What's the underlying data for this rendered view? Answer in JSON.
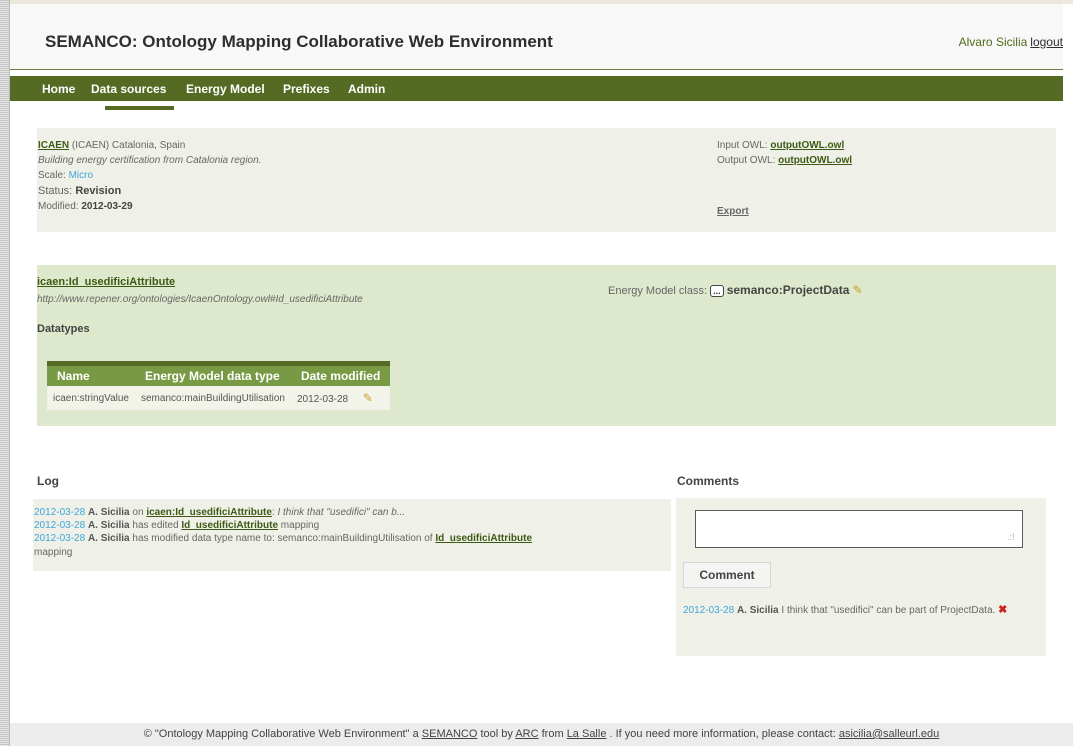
{
  "header": {
    "title": "SEMANCO: Ontology Mapping Collaborative Web Environment",
    "user_name": "Alvaro Sicilia",
    "logout_label": "logout"
  },
  "nav": {
    "items": [
      "Home",
      "Data sources",
      "Energy Model",
      "Prefixes",
      "Admin"
    ],
    "active": "Data sources"
  },
  "source": {
    "name": "ICAEN",
    "qualifier": "(ICAEN) Catalonia, Spain",
    "description": "Building energy certification from Catalonia region.",
    "scale_label": "Scale:",
    "scale_value": "Micro",
    "status_label": "Status:",
    "status_value": "Revision",
    "modified_label": "Modified:",
    "modified_value": "2012-03-29",
    "input_owl_label": "Input OWL:",
    "input_owl_value": "outputOWL.owl",
    "output_owl_label": "Output OWL:",
    "output_owl_value": "outputOWL.owl",
    "export_label": "Export"
  },
  "attribute": {
    "name": "icaen:Id_usedificiAttribute",
    "uri": "http://www.repener.org/ontologies/IcaenOntology.owl#Id_usedificiAttribute",
    "energy_model_label": "Energy Model class:",
    "energy_model_button": "...",
    "energy_model_value": "semanco:ProjectData",
    "datatypes_title": "Datatypes",
    "table": {
      "headers": [
        "Name",
        "Energy Model data type",
        "Date modified"
      ],
      "rows": [
        [
          "icaen:stringValue",
          "semanco:mainBuildingUtilisation",
          "2012-03-28"
        ]
      ]
    }
  },
  "log": {
    "title": "Log",
    "entries": [
      {
        "date": "2012-03-28",
        "user": "A. Sicilia",
        "pre": "on",
        "link": "icaen:Id_usedificiAttribute",
        "post": ": ",
        "italic": "I think that \"usedifici\" can b..."
      },
      {
        "date": "2012-03-28",
        "user": "A. Sicilia",
        "pre": "has edited",
        "link": "Id_usedificiAttribute",
        "post": " mapping"
      },
      {
        "date": "2012-03-28",
        "user": "A. Sicilia",
        "pre": "has modified data type name to: semanco:mainBuildingUtilisation of",
        "link": "Id_usedificiAttribute",
        "post": ""
      }
    ],
    "wrap": "mapping"
  },
  "comments": {
    "title": "Comments",
    "input_value": "",
    "button_label": "Comment",
    "entry": {
      "date": "2012-03-28",
      "user": "A. Sicilia",
      "text": "I think that \"usedifici\" can be part of ProjectData."
    }
  },
  "footer": {
    "prefix": "© \"Ontology Mapping Collaborative Web Environment\" a",
    "semanco": "SEMANCO",
    "mid1": "tool by",
    "arc": "ARC",
    "mid2": "from",
    "lasalle": "La Salle",
    "mid3": ". If you need more information, please contact:",
    "email": "asicilia@salleurl.edu"
  },
  "colors": {
    "nav_green": "#556b23",
    "panel_light": "#eff1e8",
    "panel_green": "#dde8cc",
    "link_blue": "#3fa5d8",
    "delete_red": "#cc2222"
  },
  "icons": {
    "edit": "pencil-icon",
    "delete": "delete-x-icon",
    "resize": "resize-grip-icon"
  }
}
